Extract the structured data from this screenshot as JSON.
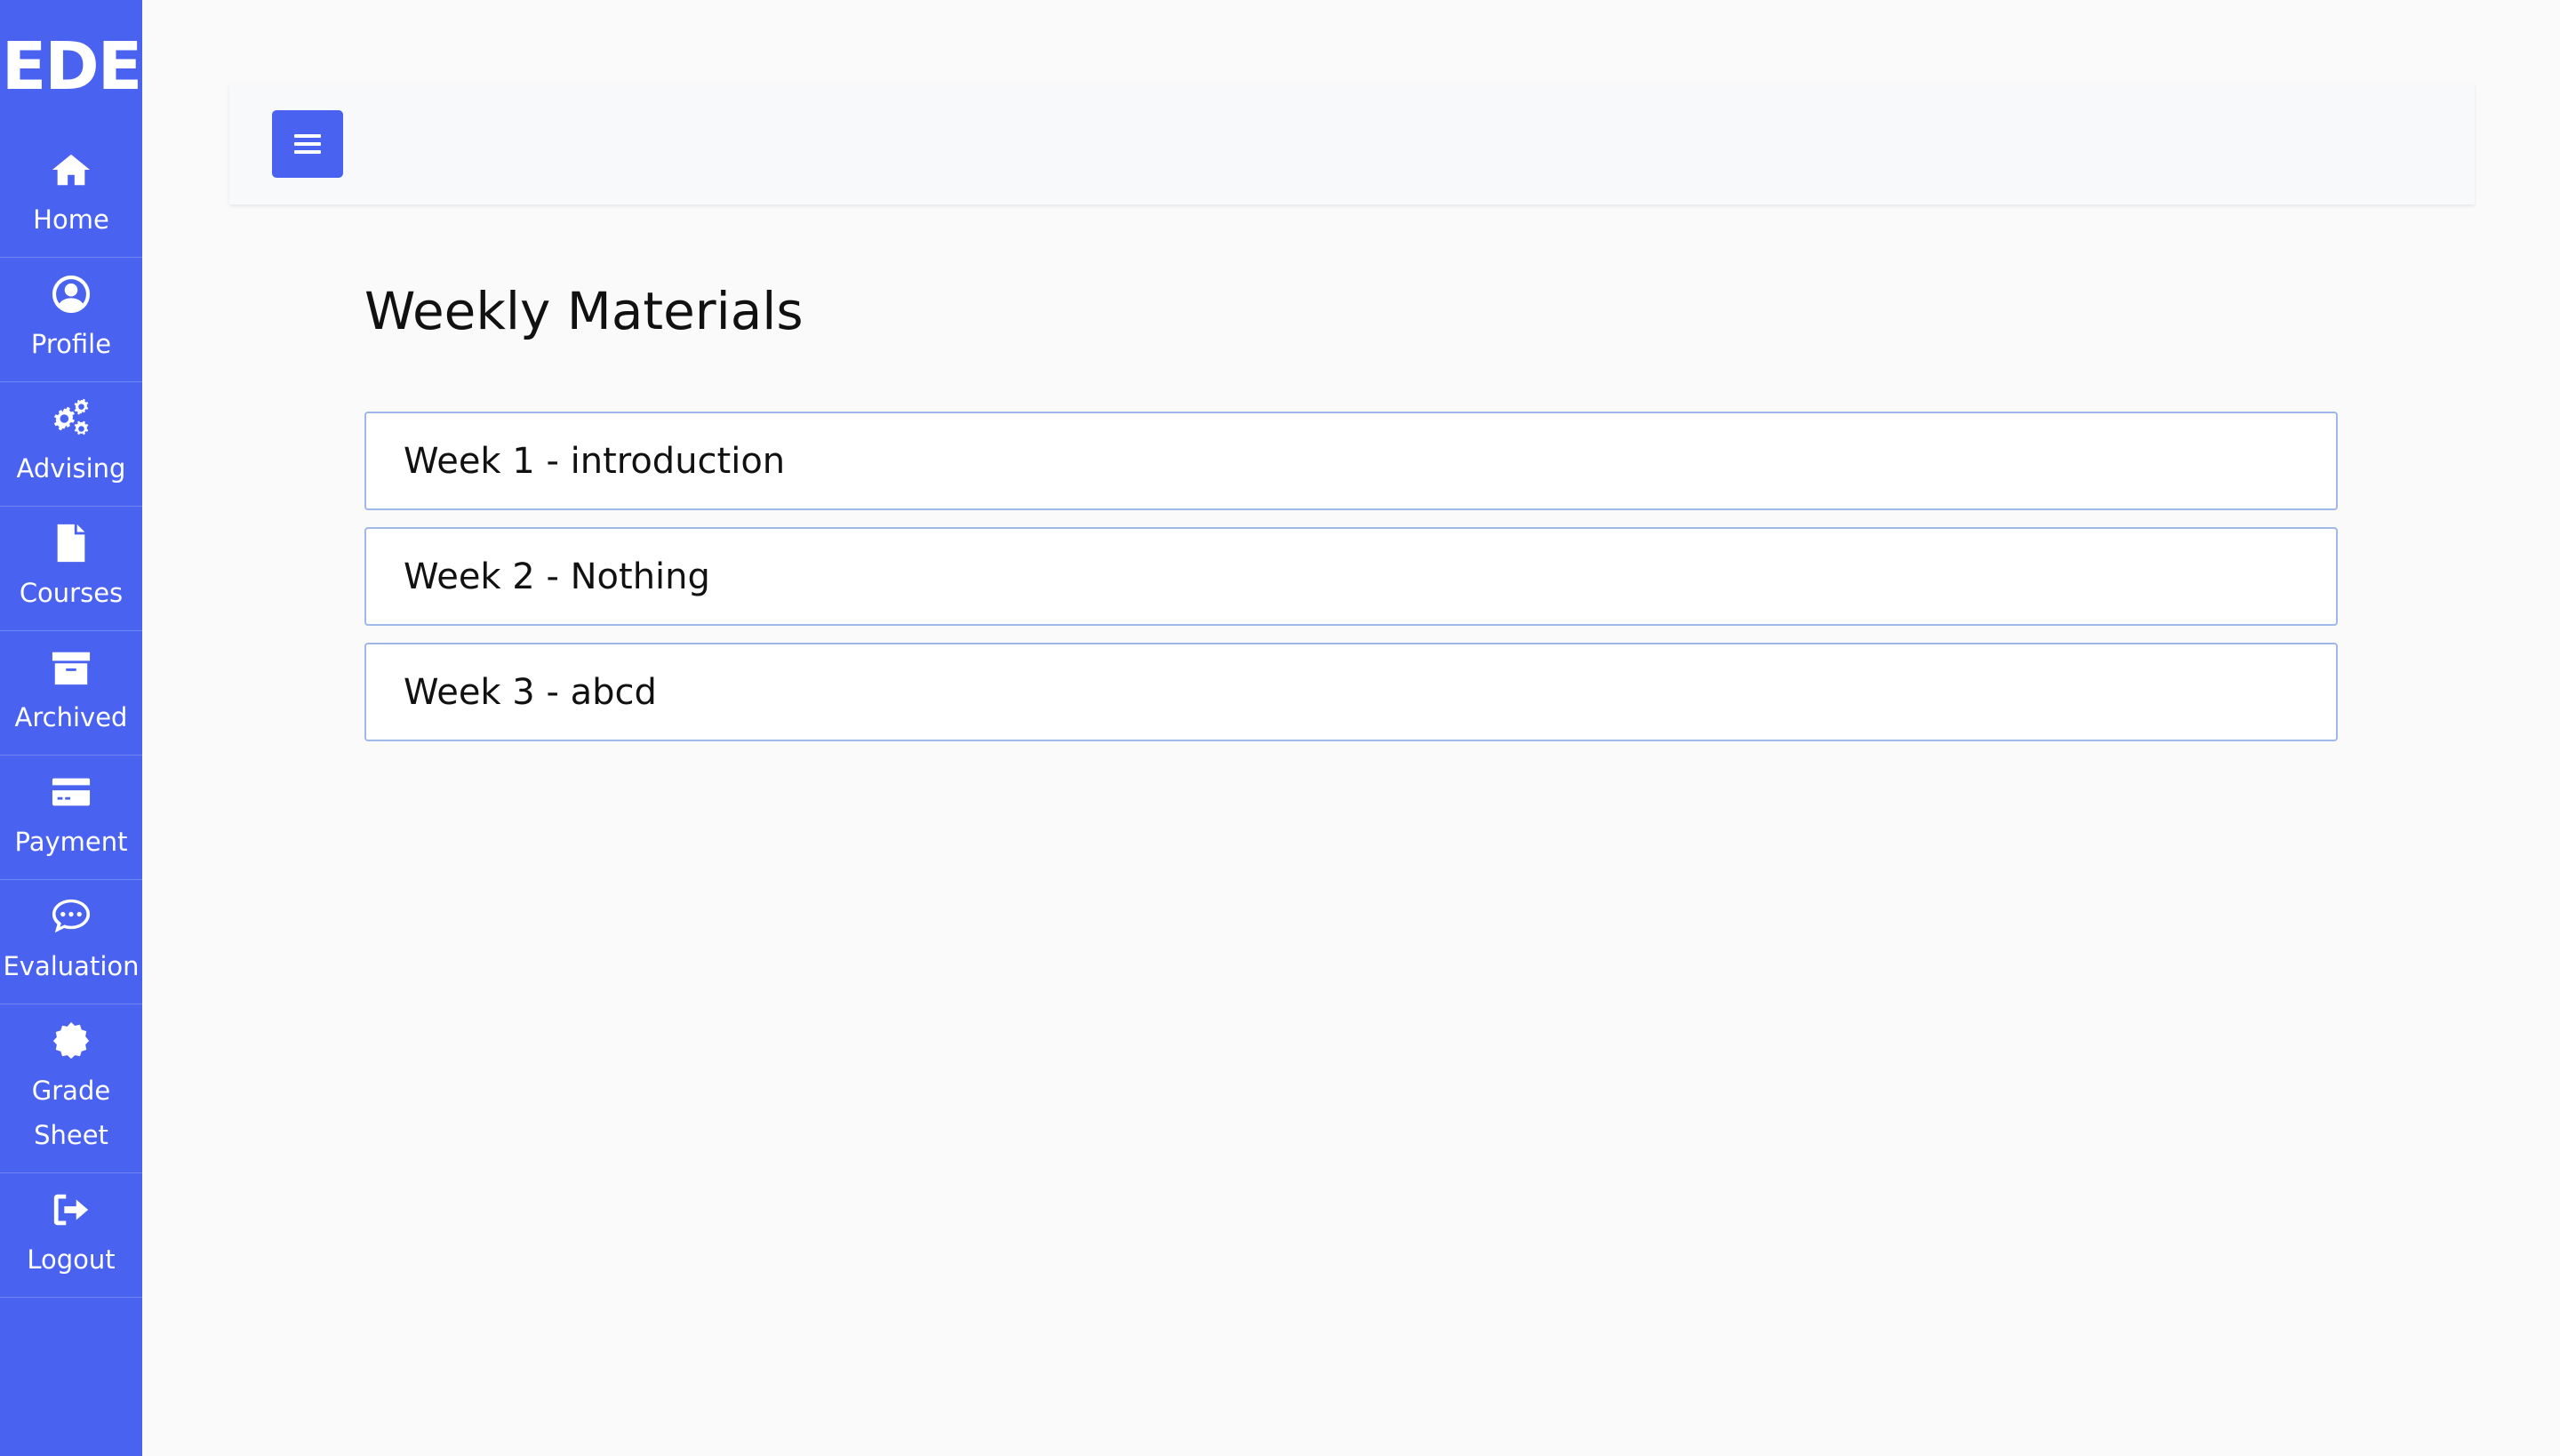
{
  "sidebar": {
    "logo": "EDE",
    "items": [
      {
        "label": "Home",
        "icon": "home-icon"
      },
      {
        "label": "Profile",
        "icon": "user-circle-icon"
      },
      {
        "label": "Advising",
        "icon": "cogs-icon"
      },
      {
        "label": "Courses",
        "icon": "file-icon"
      },
      {
        "label": "Archived",
        "icon": "archive-icon"
      },
      {
        "label": "Payment",
        "icon": "credit-card-icon"
      },
      {
        "label": "Evaluation",
        "icon": "comment-dots-icon"
      },
      {
        "label": "Grade Sheet",
        "icon": "certificate-icon"
      },
      {
        "label": "Logout",
        "icon": "sign-out-icon"
      }
    ]
  },
  "topbar": {
    "menu_icon": "hamburger-icon"
  },
  "main": {
    "title": "Weekly Materials",
    "weeks": [
      {
        "label": "Week 1 - introduction"
      },
      {
        "label": "Week 2 - Nothing"
      },
      {
        "label": "Week 3 - abcd"
      }
    ]
  },
  "colors": {
    "accent": "#4a62f0",
    "background": "#fafafa",
    "card_border": "#9fb8e8"
  }
}
